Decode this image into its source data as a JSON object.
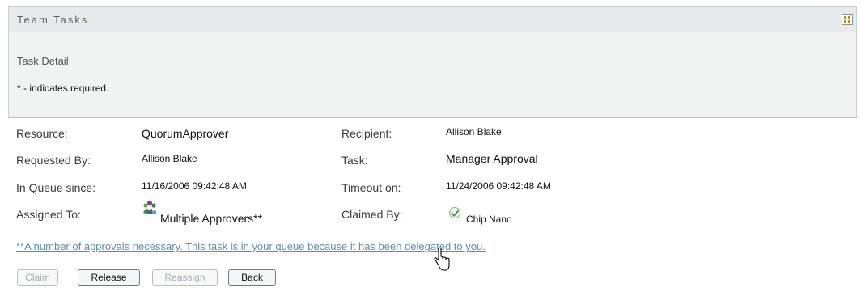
{
  "header": {
    "title": "Team Tasks",
    "settings_icon": "grid-icon"
  },
  "detail": {
    "subtitle": "Task Detail",
    "required_note": "* - indicates required."
  },
  "fields": {
    "resource": {
      "label": "Resource:",
      "value": "QuorumApprover"
    },
    "recipient": {
      "label": "Recipient:",
      "value": "Allison Blake"
    },
    "requested_by": {
      "label": "Requested By:",
      "value": "Allison Blake"
    },
    "task": {
      "label": "Task:",
      "value": "Manager Approval"
    },
    "in_queue": {
      "label": "In Queue since:",
      "value": "11/16/2006 09:42:48 AM"
    },
    "timeout": {
      "label": "Timeout on:",
      "value": "11/24/2006 09:42:48 AM"
    },
    "assigned_to": {
      "label": "Assigned To:",
      "value": "Multiple Approvers**",
      "icon": "multiple-approvers-icon"
    },
    "claimed_by": {
      "label": "Claimed By:",
      "value": "Chip Nano",
      "icon": "check-circle-icon"
    }
  },
  "note": "**A number of approvals necessary. This task is in your queue because it has been delegated to you.",
  "buttons": {
    "claim": {
      "label": "Claim",
      "enabled": false
    },
    "release": {
      "label": "Release",
      "enabled": true
    },
    "reassign": {
      "label": "Reassign",
      "enabled": false
    },
    "back": {
      "label": "Back",
      "enabled": true
    }
  },
  "colors": {
    "accent_link": "#5d8fa8",
    "title_bar": "#e6eaec",
    "header_area": "#f1f3f3"
  }
}
